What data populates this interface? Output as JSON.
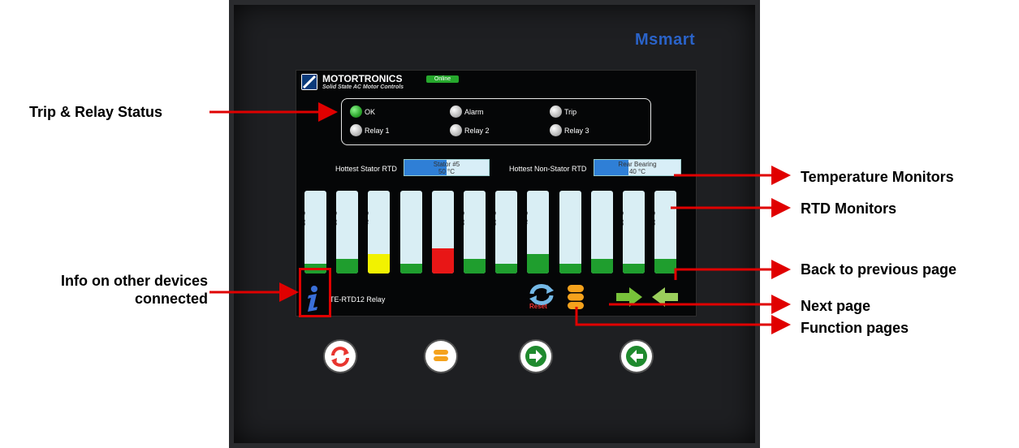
{
  "device": {
    "brand": "Msmart",
    "logo_name": "MOTORTRONICS",
    "logo_tagline": "Solid State AC Motor Controls",
    "online_label": "Online",
    "device_name": "TE-RTD12 Relay"
  },
  "status": {
    "indicators": [
      {
        "label": "OK",
        "state": "on"
      },
      {
        "label": "Alarm",
        "state": "off"
      },
      {
        "label": "Trip",
        "state": "off"
      },
      {
        "label": "Relay 1",
        "state": "off"
      },
      {
        "label": "Relay 2",
        "state": "off"
      },
      {
        "label": "Relay 3",
        "state": "off"
      }
    ]
  },
  "hottest": {
    "stator_label": "Hottest Stator RTD",
    "stator_name": "Stator #5",
    "stator_value": "50 °C",
    "nonstator_label": "Hottest Non-Stator RTD",
    "nonstator_name": "Rear Bearing",
    "nonstator_value": "40 °C"
  },
  "rtds": [
    {
      "name": "Stator #1",
      "value": "20 °C",
      "level": 0.2,
      "color": "#1f9e2e"
    },
    {
      "name": "Stator #2",
      "value": "30 °C",
      "level": 0.3,
      "color": "#1f9e2e"
    },
    {
      "name": "Stator #3",
      "value": "40 °C",
      "level": 0.4,
      "color": "#f2f200"
    },
    {
      "name": "Stator #4",
      "value": "20 °C",
      "level": 0.2,
      "color": "#1f9e2e"
    },
    {
      "name": "Stator #5",
      "value": "50 °C",
      "level": 0.5,
      "color": "#e81616"
    },
    {
      "name": "Stator #6",
      "value": "30 °C",
      "level": 0.3,
      "color": "#1f9e2e"
    },
    {
      "name": "Front Bearing",
      "value": "20 °C",
      "level": 0.2,
      "color": "#1f9e2e"
    },
    {
      "name": "Rear Bearing",
      "value": "40 °C",
      "level": 0.4,
      "color": "#1f9e2e"
    },
    {
      "name": "Bearing Box",
      "value": "20 °C",
      "level": 0.2,
      "color": "#1f9e2e"
    },
    {
      "name": "Ambient",
      "value": "30 °C",
      "level": 0.3,
      "color": "#1f9e2e"
    },
    {
      "name": "User Defined #1",
      "value": "20 °C",
      "level": 0.2,
      "color": "#1f9e2e"
    },
    {
      "name": "User Defined #2",
      "value": "30 °C",
      "level": 0.3,
      "color": "#1f9e2e"
    }
  ],
  "screen_buttons": {
    "reset_label": "Reset"
  },
  "annotations": {
    "trip_relay": "Trip & Relay Status",
    "temperature": "Temperature Monitors",
    "rtd": "RTD Monitors",
    "info_line1": "Info on other devices",
    "info_line2": "connected",
    "back": "Back to previous page",
    "next": "Next page",
    "function": "Function pages"
  },
  "colors": {
    "annotation_red": "#e00000",
    "bar_green": "#1f9e2e",
    "bar_yellow": "#f2f200",
    "bar_red": "#e81616",
    "hot_blue": "#2f7fd6"
  }
}
